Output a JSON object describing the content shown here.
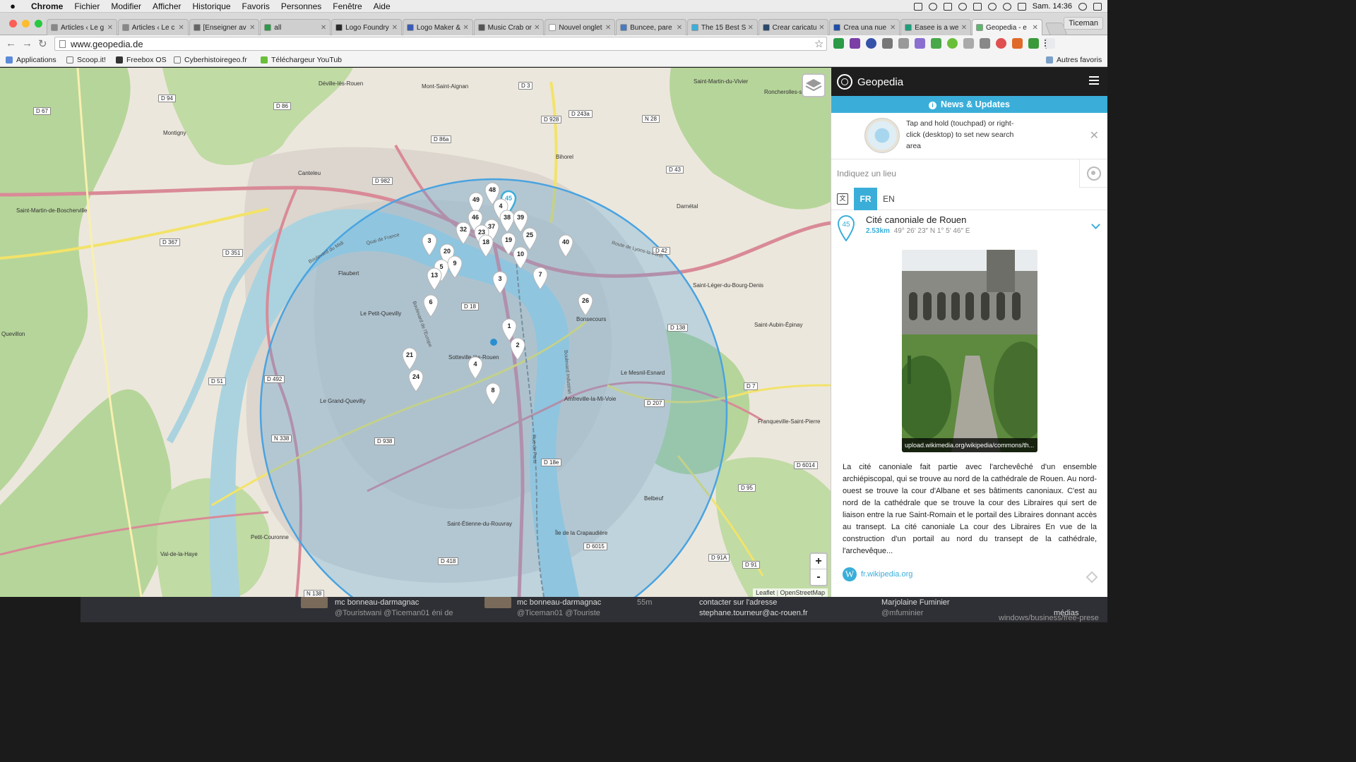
{
  "menubar": {
    "app": "Chrome",
    "items": [
      "Fichier",
      "Modifier",
      "Afficher",
      "Historique",
      "Favoris",
      "Personnes",
      "Fenêtre",
      "Aide"
    ],
    "clock": "Sam. 14:36"
  },
  "tabs": [
    {
      "label": "Articles ‹ Le g",
      "color": "#888888"
    },
    {
      "label": "Articles ‹ Le c",
      "color": "#888888"
    },
    {
      "label": "[Enseigner av",
      "color": "#666666"
    },
    {
      "label": "all",
      "color": "#2c9a46"
    },
    {
      "label": "Logo Foundry",
      "color": "#2a2a2a"
    },
    {
      "label": "Logo Maker &",
      "color": "#3b5bb5"
    },
    {
      "label": "Music Crab or",
      "color": "#555555"
    },
    {
      "label": "Nouvel onglet",
      "color": "#ffffff"
    },
    {
      "label": "Buncee, pare",
      "color": "#4a7bc1"
    },
    {
      "label": "The 15 Best S",
      "color": "#3aaed9"
    },
    {
      "label": "Crear caricatu",
      "color": "#2a4a6a"
    },
    {
      "label": "Crea una nue",
      "color": "#1e4ea8"
    },
    {
      "label": "Easee is a we",
      "color": "#1e9e7a"
    },
    {
      "label": "Geopedia - e",
      "color": "#5ab86a",
      "active": true
    }
  ],
  "profile": "Ticeman",
  "url": "www.geopedia.de",
  "bookmarks": [
    "Applications",
    "Scoop.it!",
    "Freebox OS",
    "Cyberhistoiregeo.fr",
    "Téléchargeur YouTub",
    "Autres favoris"
  ],
  "map": {
    "places": [
      "Déville-lès-Rouen",
      "Mont-Saint-Aignan",
      "Saint-Martin-du-Vivier",
      "Roncherolles-sur-le",
      "Montigny",
      "Canteleu",
      "Bihorel",
      "Saint-Martin-de-Boscherville",
      "Darnétal",
      "Flaubert",
      "Le Petit-Quevilly",
      "Sotteville-lès-Rouen",
      "Le Grand-Quevilly",
      "Quevillon",
      "Saint-Léger-du-Bourg-Denis",
      "Saint-Aubin-Épinay",
      "Le Mesnil-Esnard",
      "Amfreville-la-Mi-Voie",
      "Franqueville-Saint-Pierre",
      "Belbeuf",
      "Saint-Étienne-du-Rouvray",
      "Petit-Couronne",
      "Val-de-la-Haye",
      "Bonsecours",
      "Île de la Crapaudière"
    ],
    "roads": [
      "D 94",
      "D 67",
      "D 86",
      "D 3",
      "D 928",
      "D 243a",
      "N 28",
      "D 982",
      "D 43",
      "D 367",
      "D 351",
      "D 42",
      "D 18",
      "D 138",
      "D 492",
      "D 51",
      "N 338",
      "D 938",
      "D 18e",
      "D 6014",
      "D 95",
      "D 6015",
      "D 418",
      "D 91A",
      "D 91",
      "N 138",
      "D 7",
      "D 207",
      "D 86a"
    ],
    "street_labels": [
      "Quai de France",
      "Boulevard de l'Europe",
      "Boulevard du Midi",
      "Route de Lyons-la-Forêt",
      "Rue de Paris",
      "Boulevard Industriel"
    ],
    "markers": [
      "48",
      "49",
      "45",
      "4",
      "46",
      "38",
      "39",
      "32",
      "37",
      "25",
      "23",
      "19",
      "18",
      "40",
      "3",
      "20",
      "5",
      "9",
      "10",
      "13",
      "3",
      "7",
      "6",
      "26",
      "1",
      "2",
      "21",
      "4",
      "24",
      "8"
    ],
    "selected_marker": "45",
    "zoom_in": "+",
    "zoom_out": "-",
    "attribution_1": "Leaflet",
    "attribution_2": "OpenStreetMap"
  },
  "panel": {
    "title": "Geopedia",
    "news": "News & Updates",
    "tip": "Tap and hold (touchpad) or right-click (desktop) to set new search area",
    "search_placeholder": "Indiquez un lieu",
    "lang_fr": "FR",
    "lang_en": "EN",
    "entry": {
      "number": "45",
      "title": "Cité canoniale de Rouen",
      "distance": "2.53km",
      "coords": "49° 26′ 23″ N 1° 5′ 46″ E"
    },
    "photo_caption": "upload.wikimedia.org/wikipedia/commons/th...",
    "description": "La cité canoniale fait partie avec l'archevêché d'un ensemble archiépiscopal, qui se trouve au nord de la cathédrale de Rouen. Au nord-ouest se trouve la cour d'Albane et ses bâtiments canoniaux. C'est au nord de la cathédrale que se trouve la cour des Libraires qui sert de liaison entre la rue Saint-Romain et le portail des Libraires donnant accès au transept. La cité canoniale La cour des Libraires En vue de la construction d'un portail au nord du transept de la cathédrale, l'archevêque...",
    "source_link": "fr.wikipedia.org"
  },
  "background_window": {
    "items": [
      "mc bonneau-darmagnac",
      "@Touristwani @Ticeman01 éni de",
      "mc bonneau-darmagnac",
      "@Ticeman01 @Touriste",
      "55m",
      "contacter sur l'adresse",
      "stephane.tourneur@ac-rouen.fr",
      "Marjolaine Fuminier",
      "@mfuminier",
      "médias",
      "windows/business/free-prese"
    ]
  },
  "colors": {
    "accent": "#3aaed9",
    "search_circle": "#4aa3e0",
    "map_land": "#ece7dc",
    "forest": "#b6d59a",
    "water": "#aad3df",
    "urban": "#dcd6ce",
    "main_road": "#d98a97",
    "secondary_road": "#f2e36a",
    "header_dark": "#1e1e1e"
  }
}
